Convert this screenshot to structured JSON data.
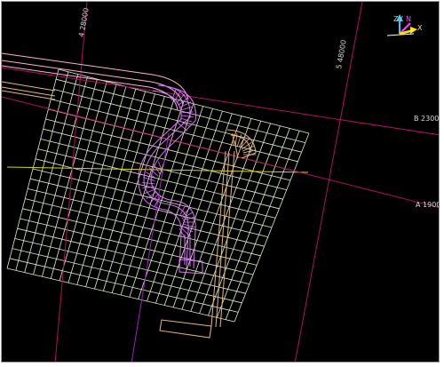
{
  "viewport": {
    "grid_labels": {
      "line_4": "4 28000",
      "line_5": "5 48000",
      "line_b": "B 23000",
      "line_a": "A 19000"
    },
    "ucs_icon": {
      "z_label": "Z",
      "y_label": "Y",
      "n_label": "N",
      "x_label": "X"
    }
  },
  "colors": {
    "background": "#000000",
    "grid_mesh": "#ddf0c8",
    "pipe_magenta": "#e070ff",
    "pipe_tan": "#e8b878",
    "pipe_pink": "#ffb0d8",
    "gridline_crimson": "#b01060",
    "gridline_purple": "#a020c0",
    "slab_edge_yellow": "#d8d800"
  },
  "icons": [
    "ucs-axis-icon"
  ]
}
